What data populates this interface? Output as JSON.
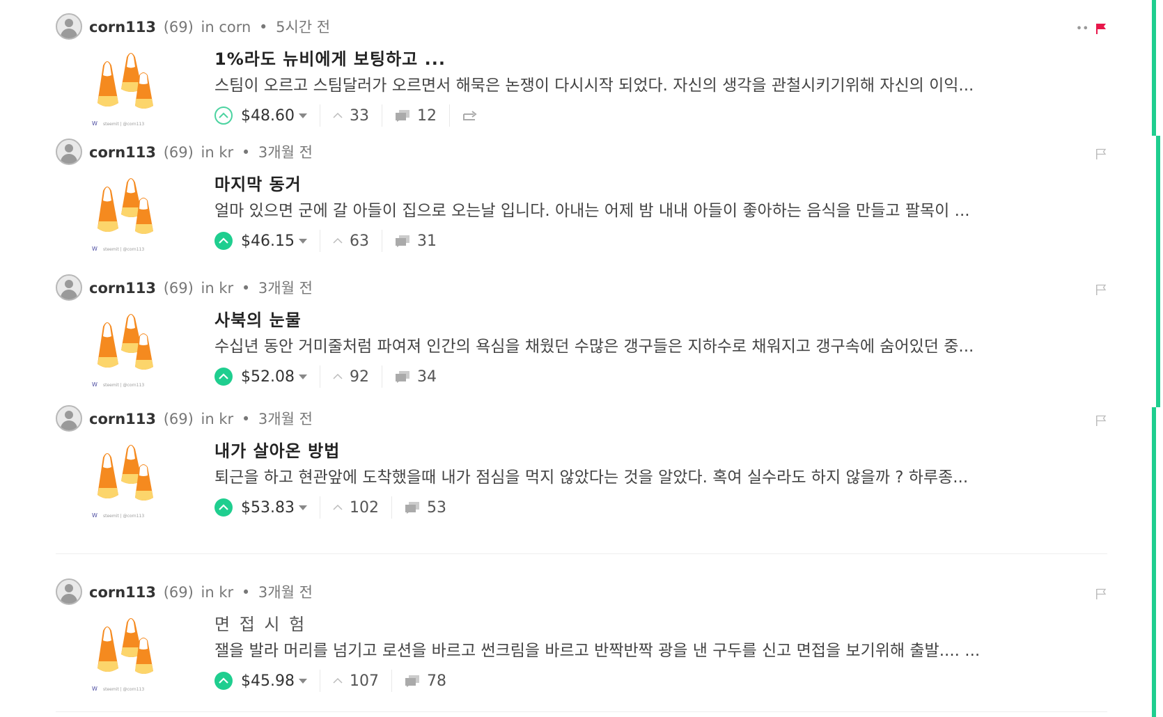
{
  "posts": [
    {
      "author": "corn113",
      "reputation": "(69)",
      "community_prefix": "in",
      "community": "corn",
      "time": "5시간 전",
      "title": "1%라도 뉴비에게 보팅하고 ...",
      "summary": "스팀이 오르고 스팀달러가 오르면서 해묵은 논쟁이 다시시작 되었다. 자신의 생각을 관철시키기위해 자신의 이익...",
      "payout": "$48.60",
      "votes": "33",
      "replies": "12",
      "voted": false
    },
    {
      "author": "corn113",
      "reputation": "(69)",
      "community_prefix": "in",
      "community": "kr",
      "time": "3개월 전",
      "title": "마지막 동거",
      "summary": "얼마 있으면 군에 갈 아들이 집으로 오는날 입니다. 아내는 어제 밤 내내 아들이 좋아하는 음식을 만들고 팔목이 ...",
      "payout": "$46.15",
      "votes": "63",
      "replies": "31",
      "voted": true
    },
    {
      "author": "corn113",
      "reputation": "(69)",
      "community_prefix": "in",
      "community": "kr",
      "time": "3개월 전",
      "title": "사북의 눈물",
      "summary": "수십년 동안 거미줄처럼 파여져 인간의 욕심을 채웠던 수많은 갱구들은 지하수로 채워지고 갱구속에 숨어있던 중...",
      "payout": "$52.08",
      "votes": "92",
      "replies": "34",
      "voted": true
    },
    {
      "author": "corn113",
      "reputation": "(69)",
      "community_prefix": "in",
      "community": "kr",
      "time": "3개월 전",
      "title": "내가 살아온 방법",
      "summary": "퇴근을 하고 현관앞에 도착했을때 내가 점심을 먹지 않았다는 것을 알았다. 혹여 실수라도 하지 않을까 ? 하루종...",
      "payout": "$53.83",
      "votes": "102",
      "replies": "53",
      "voted": true
    },
    {
      "author": "corn113",
      "reputation": "(69)",
      "community_prefix": "in",
      "community": "kr",
      "time": "3개월 전",
      "title": "면 접 시 험",
      "summary": "잴을 발라 머리를 넘기고 로션을 바르고 썬크림을 바르고 반짝반짝 광을 낸 구두를 신고 면접을 보기위해 출발.... ...",
      "payout": "$45.98",
      "votes": "107",
      "replies": "78",
      "voted": true
    }
  ],
  "colors": {
    "accent": "#1fce8f",
    "flag_active": "#e8174a",
    "flag_inactive": "#bbbbbb"
  },
  "icons": {
    "avatar": "user-avatar-icon",
    "upvote": "upvote-chevron-icon",
    "votes": "chevron-up-icon",
    "replies": "comment-bubbles-icon",
    "reblog": "reblog-icon",
    "flag": "flag-icon",
    "thumbnail": "candy-corn-logo"
  }
}
